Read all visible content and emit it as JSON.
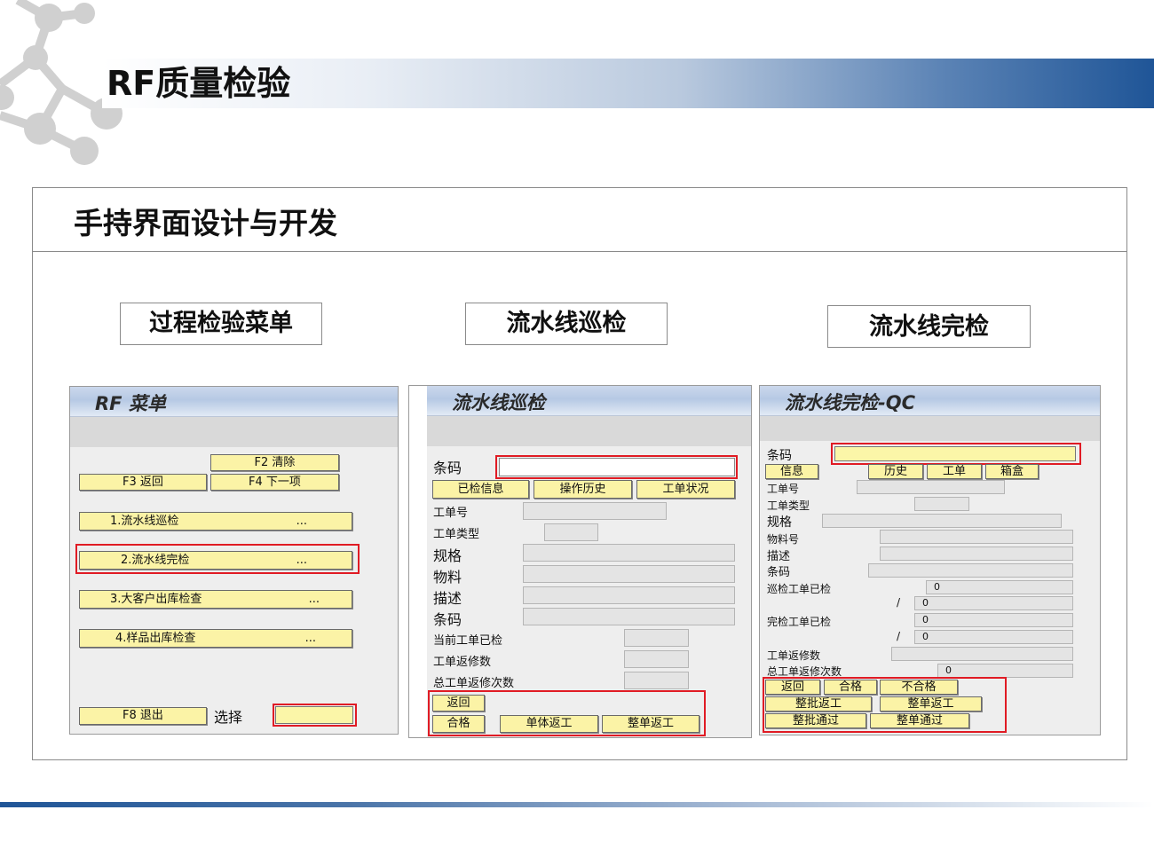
{
  "page": {
    "title": "RF质量检验",
    "section_title": "手持界面设计与开发",
    "captions": [
      "过程检验菜单",
      "流水线巡检",
      "流水线完检"
    ]
  },
  "screen1": {
    "title": "RF 菜单",
    "btn_clear": "F2 清除",
    "btn_back": "F3 返回",
    "btn_next": "F4 下一项",
    "items": [
      "1.流水线巡检",
      "2.流水线完检",
      "3.大客户出库检查",
      "4.样品出库检查"
    ],
    "ellipsis": "...",
    "btn_exit": "F8 退出",
    "select_label": "选择"
  },
  "screen2": {
    "title": "流水线巡检",
    "barcode_label": "条码",
    "btn_checked": "已检信息",
    "btn_history": "操作历史",
    "btn_status": "工单状况",
    "labels": [
      "工单号",
      "工单类型",
      "规格",
      "物料",
      "描述",
      "条码",
      "当前工单已检",
      "工单返修数",
      "总工单返修次数"
    ],
    "btn_back": "返回",
    "btn_pass": "合格",
    "btn_single_rework": "单体返工",
    "btn_whole_rework": "整单返工"
  },
  "screen3": {
    "title": "流水线完检-QC",
    "barcode_label": "条码",
    "btn_info": "信息",
    "btn_history": "历史",
    "btn_order": "工单",
    "btn_box": "箱盒",
    "labels": [
      "工单号",
      "工单类型",
      "规格",
      "物料号",
      "描述",
      "条码",
      "巡检工单已检",
      "完检工单已检",
      "工单返修数",
      "总工单返修次数"
    ],
    "slash": "/",
    "values": [
      "0",
      "0",
      "0",
      "0",
      "0"
    ],
    "btn_back": "返回",
    "btn_pass": "合格",
    "btn_fail": "不合格",
    "btn_batch_rework": "整批返工",
    "btn_order_rework": "整单返工",
    "btn_batch_pass": "整批通过",
    "btn_order_pass": "整单通过"
  },
  "colors": {
    "accent": "#1f5597",
    "button_yellow": "#fbf3a6",
    "highlight_red": "#e01b24"
  }
}
